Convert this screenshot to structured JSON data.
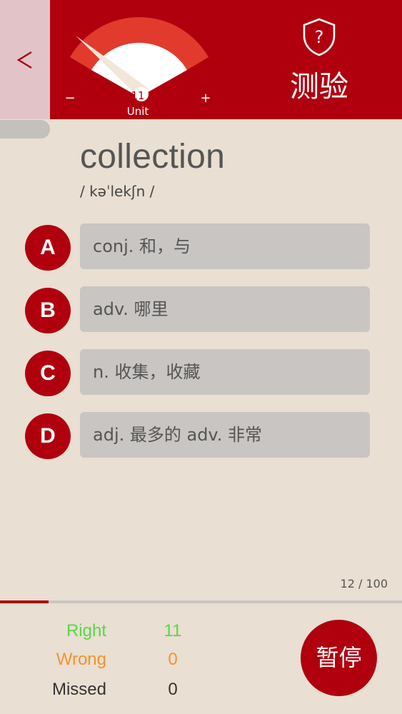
{
  "header": {
    "back_label": "<",
    "gauge": {
      "minus": "−",
      "plus": "+",
      "value": "11",
      "unit": "Unit"
    },
    "quiz_label": "测验",
    "quiz_icon": "shield-question-icon"
  },
  "word": {
    "text": "collection",
    "phonetic": "/ kəˈlekʃn /"
  },
  "options": [
    {
      "letter": "A",
      "text": "conj. 和，与"
    },
    {
      "letter": "B",
      "text": "adv. 哪里"
    },
    {
      "letter": "C",
      "text": "n. 收集，收藏"
    },
    {
      "letter": "D",
      "text": "adj. 最多的 adv. 非常"
    }
  ],
  "progress": {
    "counter": "12 / 100",
    "fraction": 0.12
  },
  "stats": {
    "right_label": "Right",
    "right_value": "11",
    "wrong_label": "Wrong",
    "wrong_value": "0",
    "missed_label": "Missed",
    "missed_value": "0"
  },
  "pause_label": "暂停",
  "colors": {
    "brand_red": "#b0000e",
    "right": "#5bd54a",
    "wrong": "#f5922b",
    "missed": "#333333"
  }
}
